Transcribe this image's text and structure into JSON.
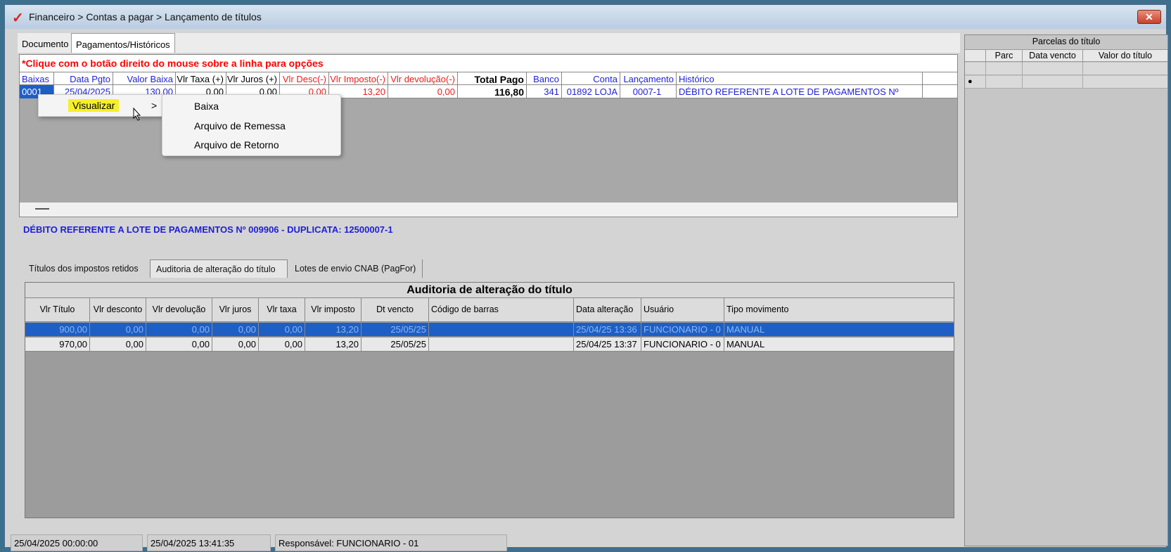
{
  "window": {
    "title": "Financeiro > Contas a pagar > Lançamento de títulos",
    "close": "✕",
    "app_icon": "✓"
  },
  "tabs_top": [
    "Documento",
    "Pagamentos/Históricos"
  ],
  "hint": "*Clique com o botão direito do mouse sobre a linha para opções",
  "payments_grid": {
    "headers": [
      "Baixas",
      "Data Pgto",
      "Valor Baixa",
      "Vlr Taxa (+)",
      "Vlr Juros (+)",
      "Vlr Desc(-)",
      "Vlr Imposto(-)",
      "Vlr devolução(-)",
      "Total Pago",
      "Banco",
      "Conta",
      "Lançamento",
      "Histórico"
    ],
    "row": {
      "baixa": "0001",
      "data": "25/04/2025",
      "valor": "130,00",
      "taxa": "0,00",
      "juros": "0,00",
      "desc": "0,00",
      "imposto": "13,20",
      "devolucao": "0,00",
      "total": "116,80",
      "banco": "341",
      "conta": "01892 LOJA",
      "lancamento": "0007-1",
      "historico": "DÉBITO REFERENTE A LOTE DE PAGAMENTOS Nº"
    }
  },
  "description": "DÉBITO REFERENTE A LOTE DE PAGAMENTOS Nº 009906 - DUPLICATA: 12500007-1",
  "tabs_bottom": [
    "Títulos dos impostos retidos",
    "Auditoria de alteração do título",
    "Lotes de envio CNAB (PagFor)"
  ],
  "audit": {
    "title": "Auditoria de alteração do título",
    "headers": [
      "Vlr Título",
      "Vlr desconto",
      "Vlr devolução",
      "Vlr juros",
      "Vlr taxa",
      "Vlr imposto",
      "Dt vencto",
      "Código de barras",
      "Data alteração",
      "Usuário",
      "Tipo  movimento"
    ],
    "rows": [
      [
        "900,00",
        "0,00",
        "0,00",
        "0,00",
        "0,00",
        "13,20",
        "25/05/25",
        "",
        "25/04/25 13:36",
        "FUNCIONARIO - 0",
        "MANUAL"
      ],
      [
        "970,00",
        "0,00",
        "0,00",
        "0,00",
        "0,00",
        "13,20",
        "25/05/25",
        "",
        "25/04/25 13:37",
        "FUNCIONARIO - 0",
        "MANUAL"
      ]
    ]
  },
  "parcelas": {
    "title": "Parcelas do título",
    "headers": [
      "Parc",
      "Data vencto",
      "Valor do título"
    ],
    "bullet": "●"
  },
  "status": [
    "25/04/2025 00:00:00",
    "25/04/2025 13:41:35",
    "Responsável: FUNCIONARIO - 01"
  ],
  "context_menu": {
    "visualizar": "Visualizar",
    "chevron": ">",
    "submenu": [
      "Baixa",
      "Arquivo de Remessa",
      "Arquivo de Retorno"
    ]
  },
  "colors": {
    "accent_blue": "#1e1ed8",
    "red": "#ee1b1b",
    "selection": "#1e5fc6",
    "highlight": "#f6ef2a"
  }
}
